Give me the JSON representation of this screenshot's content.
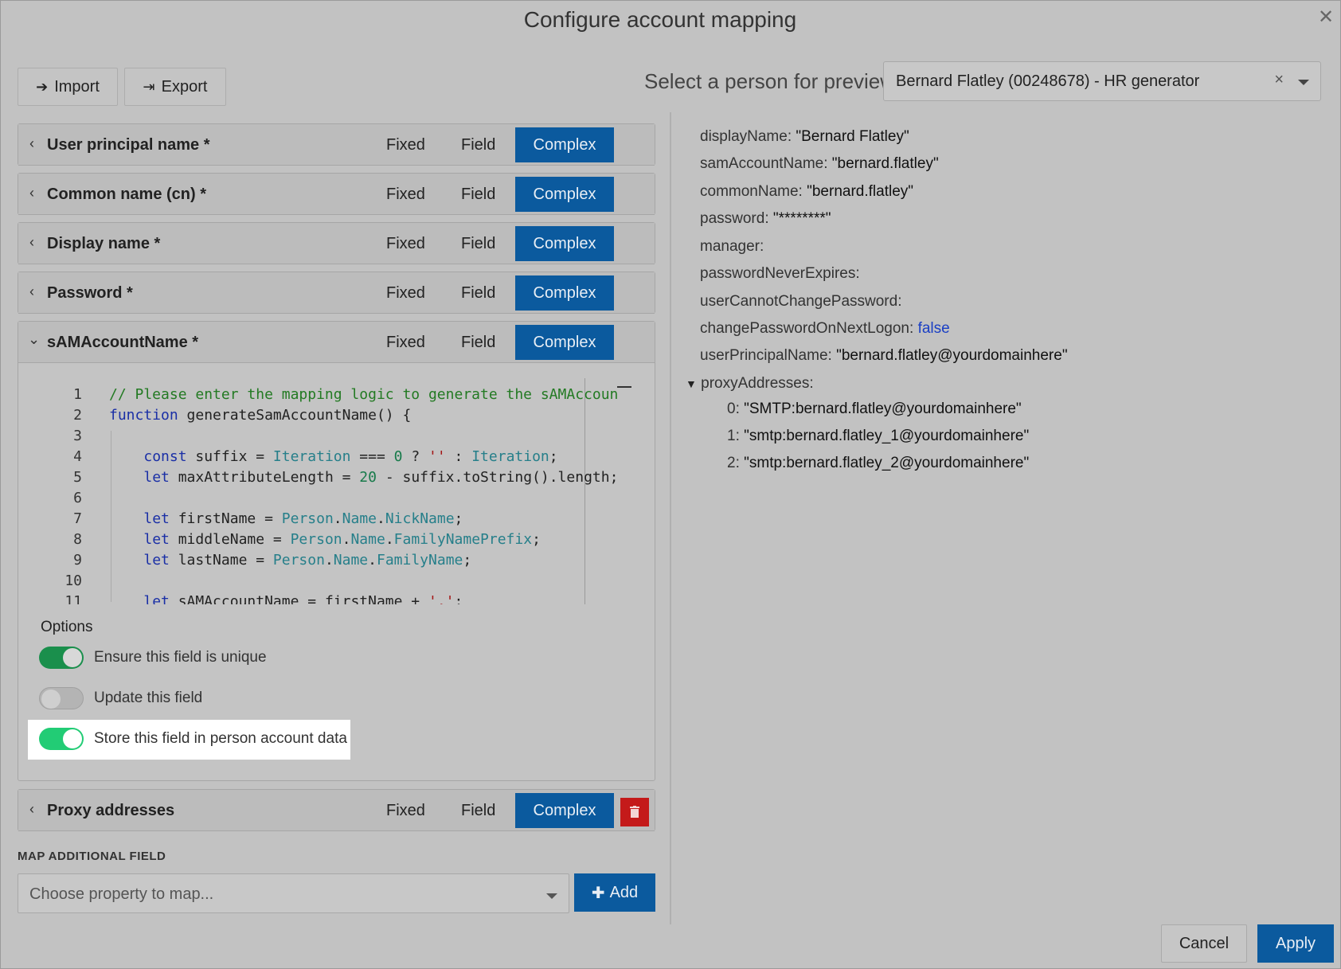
{
  "dialog": {
    "title": "Configure account mapping"
  },
  "toolbar": {
    "import_label": "Import",
    "export_label": "Export"
  },
  "preview": {
    "label": "Select a person for preview",
    "selected": "Bernard Flatley (00248678) - HR generator",
    "clear": "×"
  },
  "mode_labels": {
    "fixed": "Fixed",
    "field": "Field",
    "complex": "Complex"
  },
  "mappings": [
    {
      "name": "User principal name *"
    },
    {
      "name": "Common name (cn) *"
    },
    {
      "name": "Display name *"
    },
    {
      "name": "Password *"
    },
    {
      "name": "sAMAccountName *"
    },
    {
      "name": "Proxy addresses"
    }
  ],
  "editor": {
    "line_numbers": [
      "1",
      "2",
      "3",
      "4",
      "5",
      "6",
      "7",
      "8",
      "9",
      "10",
      "11"
    ]
  },
  "options": {
    "title": "Options",
    "items": [
      {
        "label": "Ensure this field is unique",
        "enabled": true
      },
      {
        "label": "Update this field",
        "enabled": false
      },
      {
        "label": "Store this field in person account data",
        "enabled": true
      }
    ]
  },
  "map_additional": {
    "label": "MAP ADDITIONAL FIELD",
    "placeholder": "Choose property to map...",
    "add_label": "Add"
  },
  "preview_data": {
    "displayName": {
      "key": "displayName:",
      "value": "\"Bernard Flatley\""
    },
    "samAccountName": {
      "key": "samAccountName:",
      "value": "\"bernard.flatley\""
    },
    "commonName": {
      "key": "commonName:",
      "value": "\"bernard.flatley\""
    },
    "password": {
      "key": "password:",
      "value": "\"********\""
    },
    "manager": {
      "key": "manager:",
      "value": ""
    },
    "passwordNeverExpires": {
      "key": "passwordNeverExpires:",
      "value": ""
    },
    "userCannotChangePassword": {
      "key": "userCannotChangePassword:",
      "value": ""
    },
    "changePasswordOnNextLogon": {
      "key": "changePasswordOnNextLogon:",
      "value": "false"
    },
    "userPrincipalName": {
      "key": "userPrincipalName:",
      "value": "\"bernard.flatley@yourdomainhere\""
    },
    "proxyAddresses": {
      "key": "proxyAddresses:",
      "items": [
        {
          "idx": "0:",
          "value": "\"SMTP:bernard.flatley@yourdomainhere\""
        },
        {
          "idx": "1:",
          "value": "\"smtp:bernard.flatley_1@yourdomainhere\""
        },
        {
          "idx": "2:",
          "value": "\"smtp:bernard.flatley_2@yourdomainhere\""
        }
      ]
    }
  },
  "footer": {
    "cancel_label": "Cancel",
    "apply_label": "Apply"
  }
}
